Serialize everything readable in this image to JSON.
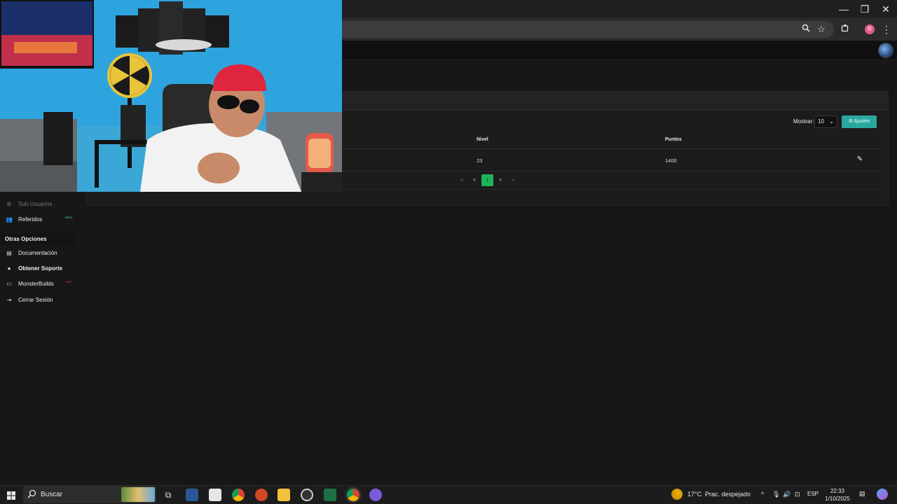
{
  "browser": {
    "minimize_glyph": "—",
    "restore_glyph": "❐",
    "close_glyph": "✕",
    "profile_initial": "R"
  },
  "table": {
    "show_label": "Mostrar:",
    "show_value": "10",
    "settings_button": "Ajustes",
    "columns": [
      "Nivel",
      "Puntos"
    ],
    "rows": [
      {
        "nivel": "23",
        "puntos": "1400"
      }
    ],
    "pagination": {
      "current_page": "1"
    }
  },
  "sidebar": {
    "items": [
      {
        "label": "Sub-Usuarios",
        "icon": "users-cog-icon"
      },
      {
        "label": "Referidos",
        "icon": "users-icon",
        "badge": "BETA"
      }
    ],
    "section_title": "Otras Opciones",
    "other_items": [
      {
        "label": "Documentación",
        "icon": "book-icon"
      },
      {
        "label": "Obtener Soporte",
        "icon": "support-icon"
      },
      {
        "label": "MonsterBuilds",
        "icon": "laptop-icon",
        "badge": "HOT"
      },
      {
        "label": "Cerrar Sesión",
        "icon": "sign-out-icon"
      }
    ]
  },
  "taskbar": {
    "search_placeholder": "Buscar",
    "weather_temp": "17°C",
    "weather_desc": "Prac. despejado",
    "language": "ESP",
    "time": "22:33",
    "date": "1/10/2025"
  },
  "colors": {
    "accent_teal": "#2aa8a0",
    "page_active_green": "#1fb45a",
    "background": "#171717"
  }
}
